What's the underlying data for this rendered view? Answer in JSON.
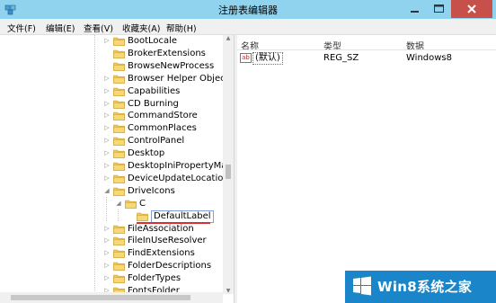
{
  "window": {
    "title": "注册表编辑器"
  },
  "menu": {
    "items": [
      "文件(F)",
      "编辑(E)",
      "查看(V)",
      "收藏夹(A)",
      "帮助(H)"
    ]
  },
  "tree": {
    "items": [
      {
        "label": "BootLocale",
        "arrow": "▷"
      },
      {
        "label": "BrokerExtensions",
        "arrow": ""
      },
      {
        "label": "BrowseNewProcess",
        "arrow": ""
      },
      {
        "label": "Browser Helper Object",
        "arrow": "▷"
      },
      {
        "label": "Capabilities",
        "arrow": "▷"
      },
      {
        "label": "CD Burning",
        "arrow": "▷"
      },
      {
        "label": "CommandStore",
        "arrow": "▷"
      },
      {
        "label": "CommonPlaces",
        "arrow": "▷"
      },
      {
        "label": "ControlPanel",
        "arrow": "▷"
      },
      {
        "label": "Desktop",
        "arrow": "▷"
      },
      {
        "label": "DesktopIniPropertyMa",
        "arrow": "▷"
      },
      {
        "label": "DeviceUpdateLocations",
        "arrow": "▷"
      },
      {
        "label": "DriveIcons",
        "arrow": "◢"
      },
      {
        "label": "C",
        "arrow": "◢"
      },
      {
        "label": "DefaultLabel",
        "arrow": ""
      },
      {
        "label": "FileAssociation",
        "arrow": "▷"
      },
      {
        "label": "FileInUseResolver",
        "arrow": "▷"
      },
      {
        "label": "FindExtensions",
        "arrow": "▷"
      },
      {
        "label": "FolderDescriptions",
        "arrow": "▷"
      },
      {
        "label": "FolderTypes",
        "arrow": "▷"
      },
      {
        "label": "FontsFolder",
        "arrow": "▷"
      }
    ]
  },
  "columns": {
    "name": "名称",
    "type": "类型",
    "data": "数据"
  },
  "values": [
    {
      "icon": "ab",
      "name": "(默认)",
      "type": "REG_SZ",
      "data": "Windows8"
    }
  ],
  "watermark": {
    "text": "Win8系统之家"
  },
  "colors": {
    "titlebar": "#8fd3ef",
    "close_button": "#c7504b",
    "folder": "#f0c859",
    "highlight_line": "#d83030",
    "watermark_bg": "#1a86c9"
  }
}
